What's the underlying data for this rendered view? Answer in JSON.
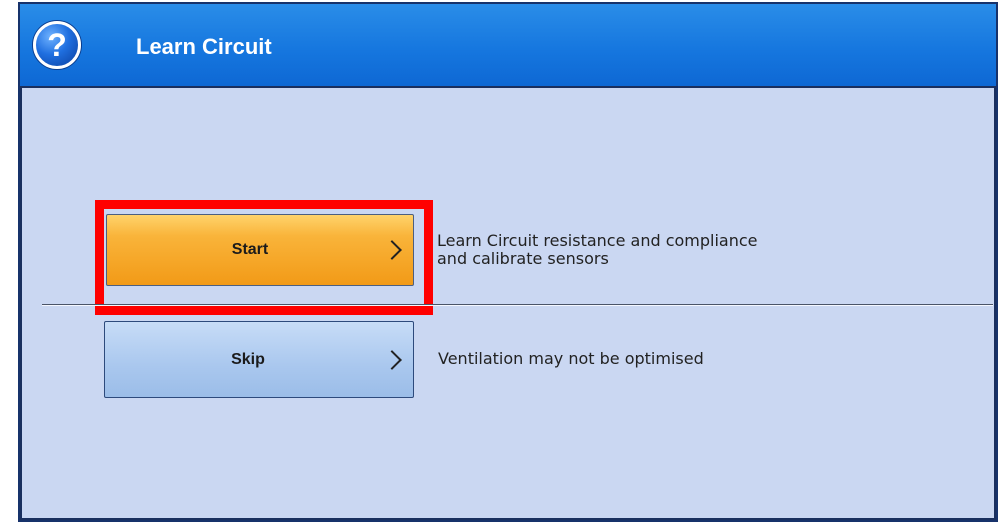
{
  "window": {
    "title": "Learn Circuit",
    "help_icon": "help-icon",
    "help_glyph": "?"
  },
  "options": [
    {
      "label": "Start",
      "description_line1": "Learn Circuit resistance and compliance",
      "description_line2": "and calibrate sensors",
      "highlighted": true,
      "icon": "chevron-right-icon"
    },
    {
      "label": "Skip",
      "description_line1": "Ventilation may not be optimised",
      "highlighted": false,
      "icon": "chevron-right-icon"
    }
  ],
  "colors": {
    "titlebar": "#1677df",
    "content_bg": "#cad7f2",
    "start_button": "#f9b43a",
    "skip_button": "#a9c7ee",
    "highlight": "#ff0000"
  }
}
